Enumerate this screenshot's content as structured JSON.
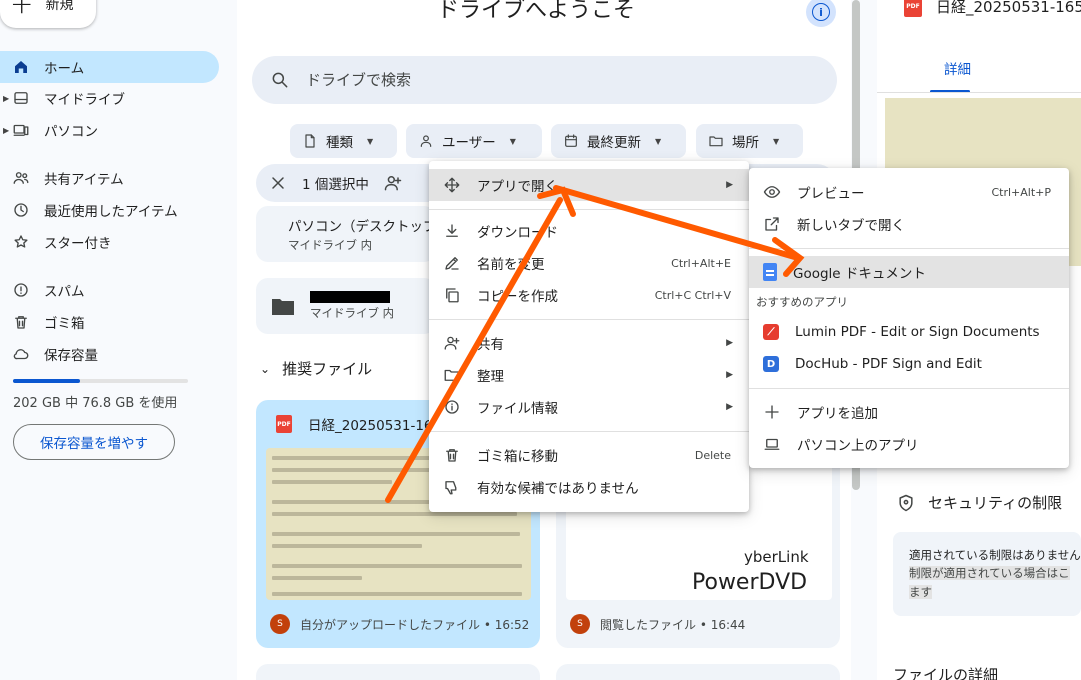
{
  "sidebar": {
    "new_label": "新規",
    "items": [
      {
        "label": "ホーム",
        "icon": "home-icon"
      },
      {
        "label": "マイドライブ",
        "icon": "my-drive-icon"
      },
      {
        "label": "パソコン",
        "icon": "computers-icon"
      },
      {
        "label": "共有アイテム",
        "icon": "shared-icon"
      },
      {
        "label": "最近使用したアイテム",
        "icon": "recent-icon"
      },
      {
        "label": "スター付き",
        "icon": "star-icon"
      },
      {
        "label": "スパム",
        "icon": "spam-icon"
      },
      {
        "label": "ゴミ箱",
        "icon": "trash-icon"
      },
      {
        "label": "保存容量",
        "icon": "cloud-icon"
      }
    ],
    "storage_text": "202 GB 中 76.8 GB を使用",
    "storage_fraction": 0.38,
    "storage_button": "保存容量を増やす"
  },
  "main": {
    "title": "ドライブへようこそ",
    "search_placeholder": "ドライブで検索",
    "chips": [
      "種類",
      "ユーザー",
      "最終更新",
      "場所"
    ],
    "selection_text": "1 個選択中",
    "folders": [
      {
        "name": "パソコン（デスクトップ）",
        "location": "マイドライブ 内"
      },
      {
        "name": "",
        "location": "マイドライブ 内"
      }
    ],
    "section_title": "推奨ファイル",
    "files": [
      {
        "name": "日経_20250531-165",
        "meta": "自分がアップロードしたファイル • 16:52",
        "avatar": "S"
      },
      {
        "name": "",
        "meta": "閲覧したファイル • 16:44",
        "avatar": "S",
        "thumb_small": "yberLink",
        "thumb_big": "PowerDVD"
      }
    ]
  },
  "context_menu": {
    "items": [
      {
        "label": "アプリで開く",
        "shortcut": "",
        "icon": "open-with-icon"
      },
      {
        "label": "ダウンロード",
        "shortcut": "",
        "icon": "download-icon"
      },
      {
        "label": "名前を変更",
        "shortcut": "Ctrl+Alt+E",
        "icon": "rename-icon"
      },
      {
        "label": "コピーを作成",
        "shortcut": "Ctrl+C Ctrl+V",
        "icon": "copy-icon"
      },
      {
        "label": "共有",
        "shortcut": "",
        "icon": "share-icon"
      },
      {
        "label": "整理",
        "shortcut": "",
        "icon": "organize-icon"
      },
      {
        "label": "ファイル情報",
        "shortcut": "",
        "icon": "info-icon"
      },
      {
        "label": "ゴミ箱に移動",
        "shortcut": "Delete",
        "icon": "trash-icon"
      },
      {
        "label": "有効な候補ではありません",
        "shortcut": "",
        "icon": "thumb-down-icon"
      }
    ]
  },
  "submenu": {
    "items": [
      {
        "label": "プレビュー",
        "shortcut": "Ctrl+Alt+P"
      },
      {
        "label": "新しいタブで開く",
        "shortcut": ""
      },
      {
        "label": "Google ドキュメント",
        "shortcut": ""
      }
    ],
    "suggested_header": "おすすめのアプリ",
    "suggested": [
      {
        "label": "Lumin PDF - Edit or Sign Documents"
      },
      {
        "label": "DocHub - PDF Sign and Edit"
      }
    ],
    "extra": [
      {
        "label": "アプリを追加"
      },
      {
        "label": "パソコン上のアプリ"
      }
    ]
  },
  "right_panel": {
    "file_title": "日経_20250531-165",
    "tab_label": "詳細",
    "security_title": "セキュリティの制限",
    "security_line1": "適用されている制限はありません",
    "security_line2": "制限が適用されている場合はこ",
    "security_line3": "ます",
    "details_title": "ファイルの詳細"
  },
  "colors": {
    "accent": "#0b57d0",
    "selected": "#c2e7ff",
    "annotation": "#ff5a00"
  }
}
